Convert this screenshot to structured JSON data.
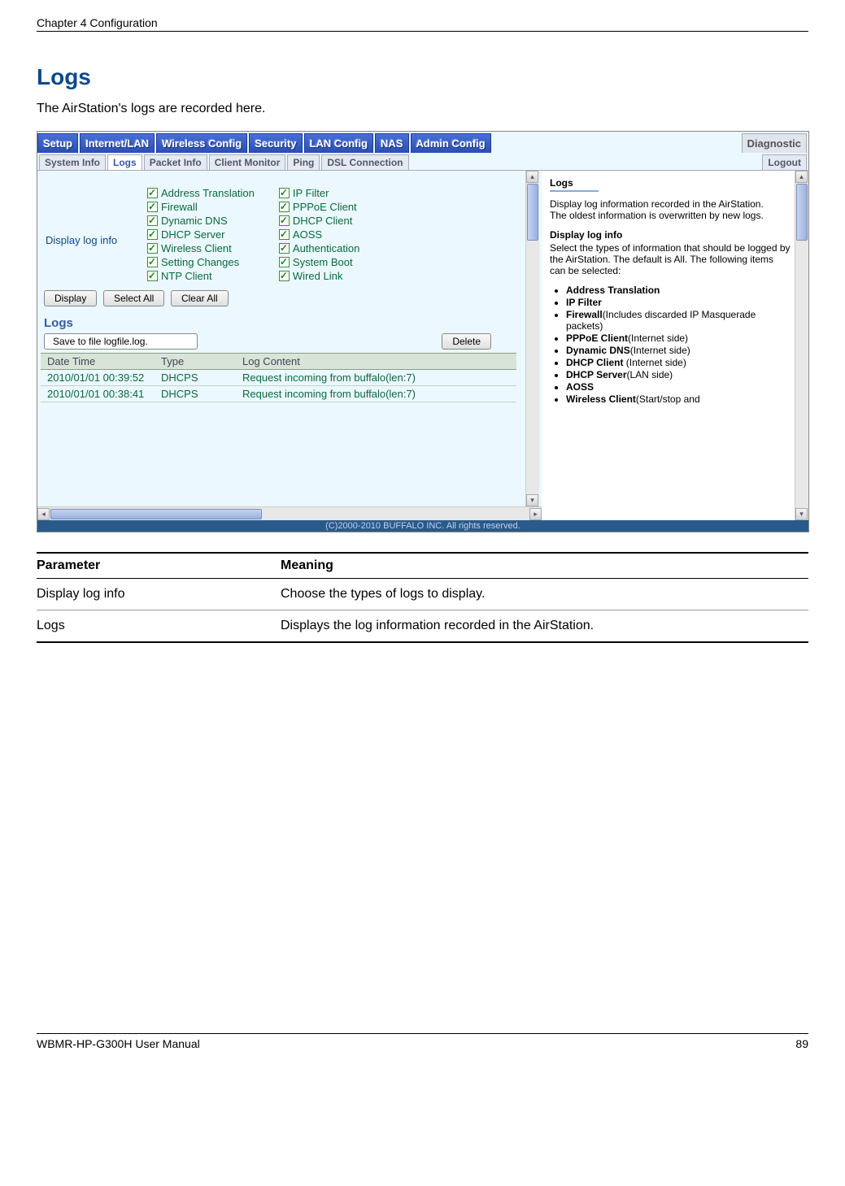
{
  "chapter": "Chapter 4  Configuration",
  "section_title": "Logs",
  "intro": "The AirStation's logs are recorded here.",
  "tabs": {
    "main": [
      "Setup",
      "Internet/LAN",
      "Wireless Config",
      "Security",
      "LAN Config",
      "NAS",
      "Admin Config"
    ],
    "diagnostic": "Diagnostic",
    "sub": [
      "System Info",
      "Logs",
      "Packet Info",
      "Client Monitor",
      "Ping",
      "DSL Connection"
    ],
    "logout": "Logout"
  },
  "config": {
    "label": "Display log info",
    "col1": [
      "Address Translation",
      "Firewall",
      "Dynamic DNS",
      "DHCP Server",
      "Wireless Client",
      "Setting Changes",
      "NTP Client"
    ],
    "col2": [
      "IP Filter",
      "PPPoE Client",
      "DHCP Client",
      "AOSS",
      "Authentication",
      "System Boot",
      "Wired Link"
    ]
  },
  "buttons": {
    "display": "Display",
    "select_all": "Select All",
    "clear_all": "Clear All",
    "delete": "Delete"
  },
  "logs": {
    "title": "Logs",
    "save_label": "Save to file logfile.log.",
    "headers": [
      "Date Time",
      "Type",
      "Log Content"
    ],
    "rows": [
      [
        "2010/01/01 00:39:52",
        "DHCPS",
        "Request incoming from buffalo(len:7)"
      ],
      [
        "2010/01/01 00:38:41",
        "DHCPS",
        "Request incoming from buffalo(len:7)"
      ]
    ]
  },
  "help": {
    "title": "Logs",
    "p1": "Display log information recorded in the AirStation.",
    "p2": "The oldest information is overwritten by new logs.",
    "h2": "Display log info",
    "p3": "Select the types of information that should be logged by the AirStation. The default is All. The following items can be selected:",
    "items": [
      {
        "b": "Address Translation",
        "t": ""
      },
      {
        "b": "IP Filter",
        "t": ""
      },
      {
        "b": "Firewall",
        "t": "(Includes discarded IP Masquerade packets)"
      },
      {
        "b": "PPPoE Client",
        "t": "(Internet side)"
      },
      {
        "b": "Dynamic DNS",
        "t": "(Internet side)"
      },
      {
        "b": "DHCP Client",
        "t": " (Internet side)"
      },
      {
        "b": "DHCP Server",
        "t": "(LAN side)"
      },
      {
        "b": "AOSS",
        "t": ""
      },
      {
        "b": "Wireless Client",
        "t": "(Start/stop and"
      }
    ]
  },
  "copyright": "(C)2000-2010 BUFFALO INC. All rights reserved.",
  "param_table": {
    "h1": "Parameter",
    "h2": "Meaning",
    "rows": [
      [
        "Display log info",
        "Choose the types of logs to display."
      ],
      [
        "Logs",
        "Displays the log information recorded in the AirStation."
      ]
    ]
  },
  "footer": {
    "left": "WBMR-HP-G300H User Manual",
    "right": "89"
  }
}
